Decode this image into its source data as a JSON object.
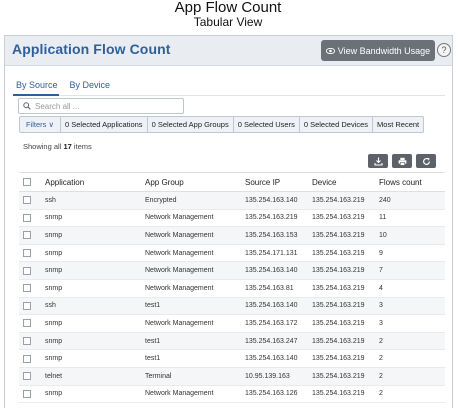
{
  "page": {
    "title": "App Flow Count",
    "subtitle": "Tabular View"
  },
  "panel": {
    "title": "Application Flow Count",
    "bandwidth_button": "View Bandwidth Usage",
    "help": "?"
  },
  "tabs": [
    {
      "label": "By Source",
      "active": true
    },
    {
      "label": "By Device",
      "active": false
    }
  ],
  "search": {
    "placeholder": "Search all ..."
  },
  "filters": {
    "label": "Filters ∨",
    "items": [
      "0 Selected Applications",
      "0 Selected App Groups",
      "0 Selected Users",
      "0 Selected Devices",
      "Most Recent"
    ]
  },
  "summary": {
    "prefix": "Showing all ",
    "count": "17",
    "suffix": " items"
  },
  "toolbar": {
    "icons": [
      "download-icon",
      "print-icon",
      "refresh-icon"
    ]
  },
  "table": {
    "columns": [
      "Application",
      "App Group",
      "Source IP",
      "Device",
      "Flows count"
    ],
    "rows": [
      [
        "ssh",
        "Encrypted",
        "135.254.163.140",
        "135.254.163.219",
        "240"
      ],
      [
        "snmp",
        "Network Management",
        "135.254.163.219",
        "135.254.163.219",
        "11"
      ],
      [
        "snmp",
        "Network Management",
        "135.254.163.153",
        "135.254.163.219",
        "10"
      ],
      [
        "snmp",
        "Network Management",
        "135.254.171.131",
        "135.254.163.219",
        "9"
      ],
      [
        "snmp",
        "Network Management",
        "135.254.163.140",
        "135.254.163.219",
        "7"
      ],
      [
        "snmp",
        "Network Management",
        "135.254.163.81",
        "135.254.163.219",
        "4"
      ],
      [
        "ssh",
        "test1",
        "135.254.163.140",
        "135.254.163.219",
        "3"
      ],
      [
        "snmp",
        "Network Management",
        "135.254.163.172",
        "135.254.163.219",
        "3"
      ],
      [
        "snmp",
        "test1",
        "135.254.163.247",
        "135.254.163.219",
        "2"
      ],
      [
        "snmp",
        "test1",
        "135.254.163.140",
        "135.254.163.219",
        "2"
      ],
      [
        "telnet",
        "Terminal",
        "10.95.139.163",
        "135.254.163.219",
        "2"
      ],
      [
        "snmp",
        "Network Management",
        "135.254.163.126",
        "135.254.163.219",
        "2"
      ]
    ]
  },
  "colors": {
    "accent": "#2f5f9a",
    "button": "#6c7178",
    "header_bg": "#e9edf2"
  }
}
